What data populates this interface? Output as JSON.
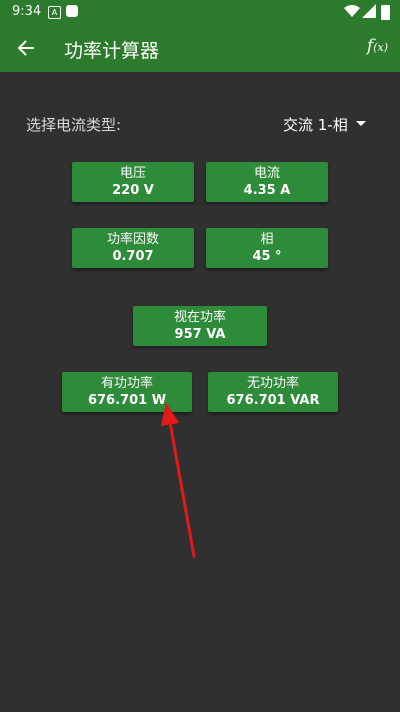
{
  "status_bar": {
    "time": "9:34",
    "notif_icon_letter": "A"
  },
  "app_bar": {
    "title": "功率计算器",
    "fx_main": "f",
    "fx_sub": "(x)"
  },
  "current_type": {
    "label": "选择电流类型:",
    "value": "交流 1-相"
  },
  "fields": {
    "voltage": {
      "label": "电压",
      "value": "220 V"
    },
    "current": {
      "label": "电流",
      "value": "4.35 A"
    },
    "power_factor": {
      "label": "功率因数",
      "value": "0.707"
    },
    "phase": {
      "label": "相",
      "value": "45 °"
    },
    "apparent_power": {
      "label": "视在功率",
      "value": "957 VA"
    },
    "active_power": {
      "label": "有功功率",
      "value": "676.701 W"
    },
    "reactive_power": {
      "label": "无功功率",
      "value": "676.701 VAR"
    }
  },
  "colors": {
    "bar": "#2c7a2c",
    "button": "#2e8b3a",
    "background": "#303030",
    "annotation_arrow": "#e11a1a"
  }
}
